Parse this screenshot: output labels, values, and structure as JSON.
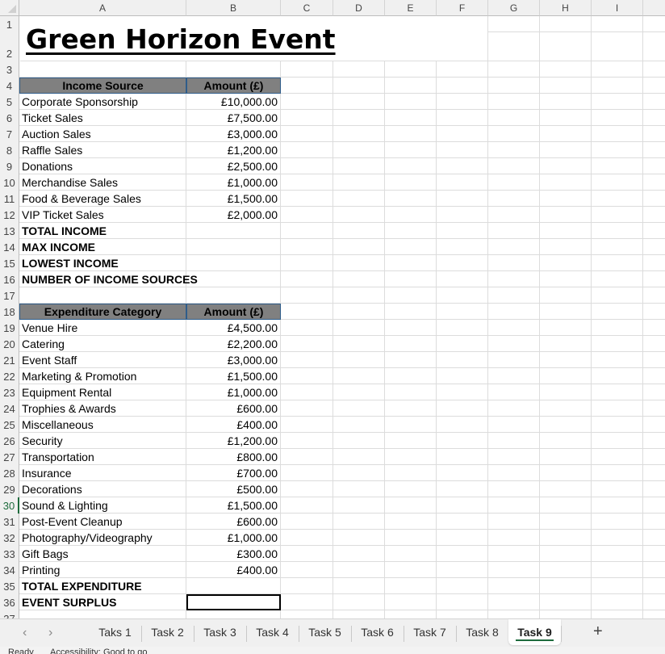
{
  "columns": [
    "A",
    "B",
    "C",
    "D",
    "E",
    "F",
    "G",
    "H",
    "I"
  ],
  "title": "Green Horizon Event",
  "income": {
    "header": [
      "Income Source",
      "Amount (£)"
    ],
    "rows": [
      [
        "Corporate Sponsorship",
        "£10,000.00"
      ],
      [
        "Ticket Sales",
        "£7,500.00"
      ],
      [
        "Auction Sales",
        "£3,000.00"
      ],
      [
        "Raffle Sales",
        "£1,200.00"
      ],
      [
        "Donations",
        "£2,500.00"
      ],
      [
        "Merchandise Sales",
        "£1,000.00"
      ],
      [
        "Food & Beverage Sales",
        "£1,500.00"
      ],
      [
        "VIP Ticket Sales",
        "£2,000.00"
      ]
    ],
    "summary": [
      "TOTAL INCOME",
      "MAX INCOME",
      "LOWEST INCOME",
      "NUMBER OF INCOME SOURCES"
    ]
  },
  "expenditure": {
    "header": [
      "Expenditure Category",
      "Amount (£)"
    ],
    "rows": [
      [
        "Venue Hire",
        "£4,500.00"
      ],
      [
        "Catering",
        "£2,200.00"
      ],
      [
        "Event Staff",
        "£3,000.00"
      ],
      [
        "Marketing & Promotion",
        "£1,500.00"
      ],
      [
        "Equipment Rental",
        "£1,000.00"
      ],
      [
        "Trophies & Awards",
        "£600.00"
      ],
      [
        "Miscellaneous",
        "£400.00"
      ],
      [
        "Security",
        "£1,200.00"
      ],
      [
        "Transportation",
        "£800.00"
      ],
      [
        "Insurance",
        "£700.00"
      ],
      [
        "Decorations",
        "£500.00"
      ],
      [
        "Sound & Lighting",
        "£1,500.00"
      ],
      [
        "Post-Event Cleanup",
        "£600.00"
      ],
      [
        "Photography/Videography",
        "£1,000.00"
      ],
      [
        "Gift Bags",
        "£300.00"
      ],
      [
        "Printing",
        "£400.00"
      ]
    ],
    "summary": [
      "TOTAL EXPENDITURE",
      "EVENT SURPLUS"
    ]
  },
  "active_row": 30,
  "sheet_tabs": [
    "Taks 1",
    "Task 2",
    "Task 3",
    "Task 4",
    "Task 5",
    "Task 6",
    "Task 7",
    "Task 8",
    "Task 9"
  ],
  "active_tab": "Task 9",
  "nav": {
    "prev": "‹",
    "next": "›",
    "add": "+"
  },
  "status": {
    "ready": "Ready",
    "accessibility": "Accessibility: Good to go"
  },
  "colors": {
    "header_fill": "#808080",
    "accent": "#1e6b3d"
  }
}
